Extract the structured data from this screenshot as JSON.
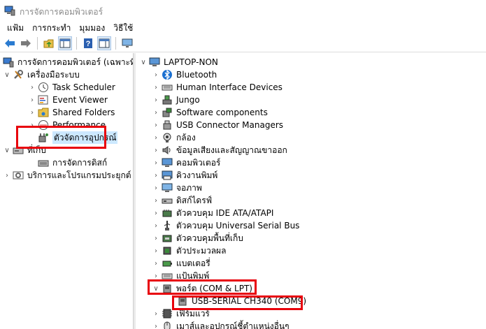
{
  "window": {
    "title": "การจัดการคอมพิวเตอร์"
  },
  "menu": [
    "แฟ้ม",
    "การกระทำ",
    "มุมมอง",
    "วิธีใช้"
  ],
  "toolbar": {
    "buttons": [
      "back-arrow-icon",
      "forward-arrow-icon",
      "up-folder-icon",
      "show-hide-tree-icon",
      "help-icon",
      "properties-icon",
      "monitor-icon"
    ]
  },
  "left_tree": {
    "root": "การจัดการคอมพิวเตอร์ (เฉพาะที่)",
    "system_tools": "เครื่องมือระบบ",
    "task_scheduler": "Task Scheduler",
    "event_viewer": "Event Viewer",
    "shared_folders": "Shared Folders",
    "performance": "Performance",
    "device_manager": "ตัวจัดการอุปกรณ์",
    "storage": "ที่เก็บ",
    "disk_management": "การจัดการดิสก์",
    "services": "บริการและโปรแกรมประยุกต์"
  },
  "device_tree": {
    "computer": "LAPTOP-NON",
    "categories": [
      {
        "label": "Bluetooth",
        "icon": "bluetooth-icon"
      },
      {
        "label": "Human Interface Devices",
        "icon": "hid-keyboard-icon"
      },
      {
        "label": "Jungo",
        "icon": "jungo-device-icon"
      },
      {
        "label": "Software components",
        "icon": "software-component-icon"
      },
      {
        "label": "USB Connector Managers",
        "icon": "usb-connector-icon"
      },
      {
        "label": "กล้อง",
        "icon": "camera-icon"
      },
      {
        "label": "ข้อมูลเสียงและสัญญาณขาออก",
        "icon": "speaker-icon"
      },
      {
        "label": "คอมพิวเตอร์",
        "icon": "computer-icon"
      },
      {
        "label": "คิวงานพิมพ์",
        "icon": "print-queue-icon"
      },
      {
        "label": "จอภาพ",
        "icon": "display-icon"
      },
      {
        "label": "ดิสก์ไดรฟ์",
        "icon": "disk-drive-icon"
      },
      {
        "label": "ตัวควบคุม IDE ATA/ATAPI",
        "icon": "ide-controller-icon"
      },
      {
        "label": "ตัวควบคุม Universal Serial Bus",
        "icon": "usb-icon"
      },
      {
        "label": "ตัวควบคุมพื้นที่เก็บ",
        "icon": "storage-controller-icon"
      },
      {
        "label": "ตัวประมวลผล",
        "icon": "processor-icon"
      },
      {
        "label": "แบตเตอรี่",
        "icon": "battery-icon"
      },
      {
        "label": "แป้นพิมพ์",
        "icon": "keyboard-icon"
      }
    ],
    "ports": "พอร์ต (COM & LPT)",
    "ports_child": "USB-SERIAL CH340 (COM9)",
    "after": [
      {
        "label": "เฟิร์มแวร์",
        "icon": "firmware-icon"
      },
      {
        "label": "เมาส์และอุปกรณ์ชี้ตำแหน่งอื่นๆ",
        "icon": "mouse-icon"
      }
    ]
  },
  "colors": {
    "highlight": "#e8000b",
    "selection": "#cce8ff"
  }
}
